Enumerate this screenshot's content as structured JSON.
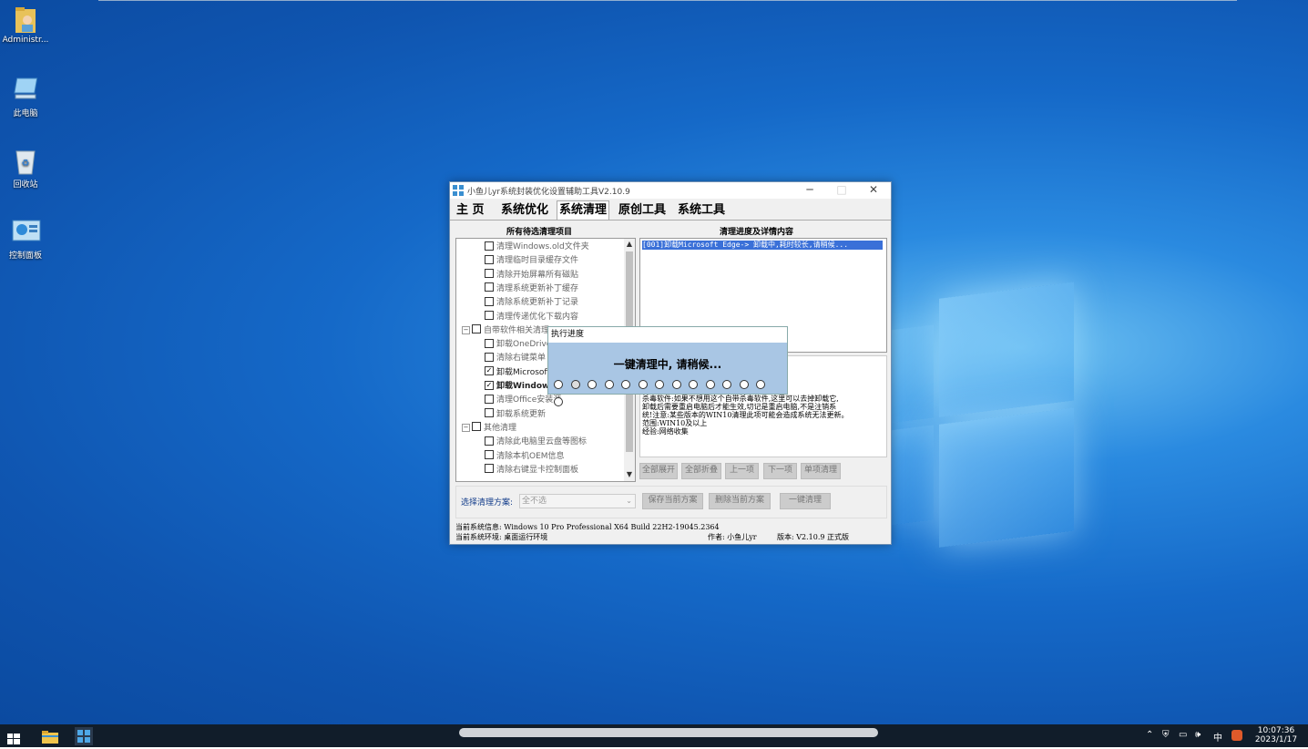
{
  "desktop": {
    "icons": [
      {
        "label": "Administr..."
      },
      {
        "label": "此电脑"
      },
      {
        "label": "回收站"
      },
      {
        "label": "控制面板"
      }
    ]
  },
  "window": {
    "title": "小鱼儿yr系统封装优化设置辅助工具V2.10.9",
    "tabs": [
      "主 页",
      "系统优化",
      "系统清理",
      "原创工具",
      "系统工具"
    ],
    "left_header": "所有待选清理项目",
    "right_header": "清理进度及详情内容",
    "tree": [
      {
        "label": "清理Windows.old文件夹",
        "checked": false
      },
      {
        "label": "清理临时目录缓存文件",
        "checked": false
      },
      {
        "label": "清除开始屏幕所有磁贴",
        "checked": false
      },
      {
        "label": "清理系统更新补丁缓存",
        "checked": false
      },
      {
        "label": "清除系统更新补丁记录",
        "checked": false
      },
      {
        "label": "清理传递优化下载内容",
        "checked": false
      },
      {
        "label": "自带软件相关清理",
        "checked": false,
        "group": true
      },
      {
        "label": "卸载OneDrive",
        "checked": false
      },
      {
        "label": "清除右键菜单",
        "checked": false
      },
      {
        "label": "卸载Microsoft",
        "checked": true
      },
      {
        "label": "卸载Windows",
        "checked": true
      },
      {
        "label": "清理Office安装源",
        "checked": false
      },
      {
        "label": "卸载系统更新",
        "checked": false
      },
      {
        "label": "其他清理",
        "checked": false,
        "group": true
      },
      {
        "label": "清除此电脑里云盘等图标",
        "checked": false
      },
      {
        "label": "清除本机OEM信息",
        "checked": false
      },
      {
        "label": "清除右键显卡控制面板",
        "checked": false
      }
    ],
    "log_line": "[001]卸载Microsoft Edge-> 卸载中,耗时较长,请稍候...",
    "description": "一个六亲不认的杀毒软\n件有没有用,听天由命\n而杀毒随时都在偷偷更新\n保护,这个自带了杀毒软件\n杀毒软件:如果不想用这个自带杀毒软件,这里可以去掉卸载它,\n卸载后需要重启电脑后才能生效,切记是重启电脑,不是注销系\n统!注意:某些版本的WIN10清理此项可能会造成系统无法更新。\n范围:WIN10及以上\n经验:网络收集",
    "action_buttons": [
      "全部展开",
      "全部折叠",
      "上一项",
      "下一项",
      "单项清理"
    ],
    "scheme_label": "选择清理方案:",
    "scheme_value": "全不选",
    "scheme_buttons": [
      "保存当前方案",
      "删除当前方案",
      "一键清理"
    ],
    "status_line1": "当前系统信息: Windows 10 Pro Professional X64 Build 22H2-19045.2364",
    "status_line2": "当前系统环境: 桌面运行环境",
    "author": "作者: 小鱼儿yr",
    "version": "版本: V2.10.9 正式版"
  },
  "popup": {
    "title": "执行进度",
    "message": "一键清理中, 请稍候...",
    "dot_count": 14,
    "active_dot": 2
  },
  "taskbar": {
    "time": "10:07:36",
    "date": "2023/1/17",
    "ime": "中"
  }
}
